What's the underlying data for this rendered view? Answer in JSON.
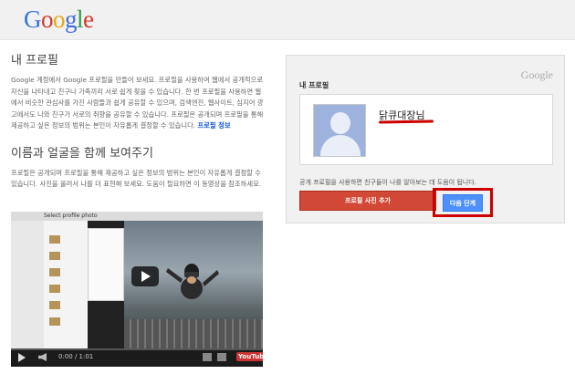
{
  "header": {
    "logo_letters": [
      "G",
      "o",
      "o",
      "g",
      "l",
      "e"
    ]
  },
  "intro": {
    "title": "내 프로필",
    "paragraph": "Google 계정에서 Google 프로필을 만들어 보세요. 프로필을 사용하여 웹에서 공개적으로 자신을 나타내고 친구나 가족끼리 서로 쉽게 찾을 수 있습니다. 한 번 프로필을 사용하면 웹에서 비슷한 관심사를 가진 사람들과 쉽게 공유할 수 있으며, 검색엔진, 웹사이트, 심지어 광고에서도 나와 친구가 서로의 취향을 공유할 수 있습니다. 프로필은 공개되며 프로필을 통해 제공하고 싶은 정보의 범위는 본인이 자유롭게 결정할 수 있습니다.",
    "link": "프로필 정보"
  },
  "section2": {
    "title": "이름과 얼굴을 함께 보여주기",
    "paragraph": "프로필은 공개되며 프로필을 통해 제공하고 싶은 정보의 범위는 본인이 자유롭게 결정할 수 있습니다. 사진을 올려서 나를 더 표현해 보세요. 도움이 필요하면 이 동영상을 참조하세요."
  },
  "video": {
    "window_title": "Select profile photo",
    "time": "0:00 / 1:01",
    "logo": "YouTube",
    "progress": 0
  },
  "card": {
    "brand": "Google",
    "title": "내 프로필",
    "profile_name": "닭큐대장님",
    "description": "공개 프로필을 사용하면 친구들이 나를 알아보는 데 도움이 됩니다.",
    "add_photo_label": "프로필 사진 추가",
    "next_label": "다음 단계"
  },
  "colors": {
    "add_button": "#d14836",
    "next_button": "#4d90fe",
    "highlight": "#cc0000"
  }
}
